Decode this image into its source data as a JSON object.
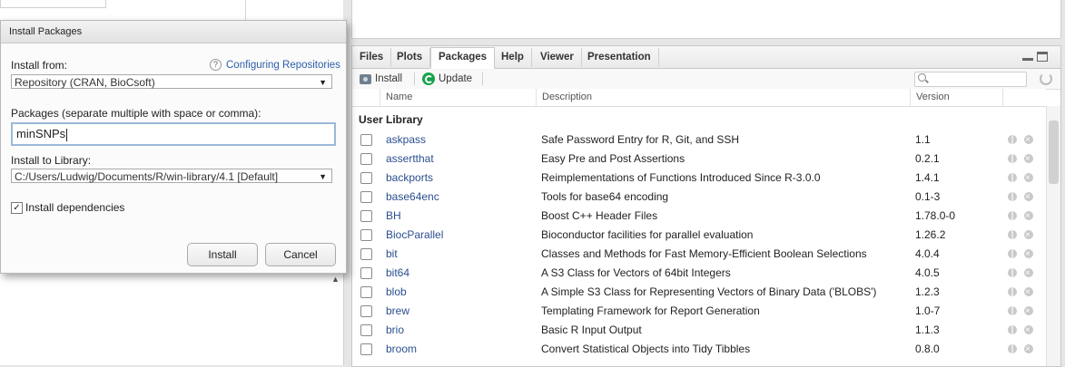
{
  "dialog": {
    "title": "Install Packages",
    "install_from_label": "Install from:",
    "help_link": "Configuring Repositories",
    "repository_value": "Repository (CRAN, BioCsoft)",
    "packages_label": "Packages (separate multiple with space or comma):",
    "packages_value": "minSNPs",
    "library_label": "Install to Library:",
    "library_value": "C:/Users/Ludwig/Documents/R/win-library/4.1 [Default]",
    "deps_label": "Install dependencies",
    "deps_checked": true,
    "install_button": "Install",
    "cancel_button": "Cancel"
  },
  "tabs": [
    "Files",
    "Plots",
    "Packages",
    "Help",
    "Viewer",
    "Presentation"
  ],
  "active_tab": "Packages",
  "toolbar": {
    "install_label": "Install",
    "update_label": "Update"
  },
  "columns": {
    "name": "Name",
    "description": "Description",
    "version": "Version"
  },
  "section_title": "User Library",
  "packages": [
    {
      "name": "askpass",
      "description": "Safe Password Entry for R, Git, and SSH",
      "version": "1.1"
    },
    {
      "name": "assertthat",
      "description": "Easy Pre and Post Assertions",
      "version": "0.2.1"
    },
    {
      "name": "backports",
      "description": "Reimplementations of Functions Introduced Since R-3.0.0",
      "version": "1.4.1"
    },
    {
      "name": "base64enc",
      "description": "Tools for base64 encoding",
      "version": "0.1-3"
    },
    {
      "name": "BH",
      "description": "Boost C++ Header Files",
      "version": "1.78.0-0"
    },
    {
      "name": "BiocParallel",
      "description": "Bioconductor facilities for parallel evaluation",
      "version": "1.26.2"
    },
    {
      "name": "bit",
      "description": "Classes and Methods for Fast Memory-Efficient Boolean Selections",
      "version": "4.0.4"
    },
    {
      "name": "bit64",
      "description": "A S3 Class for Vectors of 64bit Integers",
      "version": "4.0.5"
    },
    {
      "name": "blob",
      "description": "A Simple S3 Class for Representing Vectors of Binary Data ('BLOBS')",
      "version": "1.2.3"
    },
    {
      "name": "brew",
      "description": "Templating Framework for Report Generation",
      "version": "1.0-7"
    },
    {
      "name": "brio",
      "description": "Basic R Input Output",
      "version": "1.1.3"
    },
    {
      "name": "broom",
      "description": "Convert Statistical Objects into Tidy Tibbles",
      "version": "0.8.0"
    }
  ]
}
